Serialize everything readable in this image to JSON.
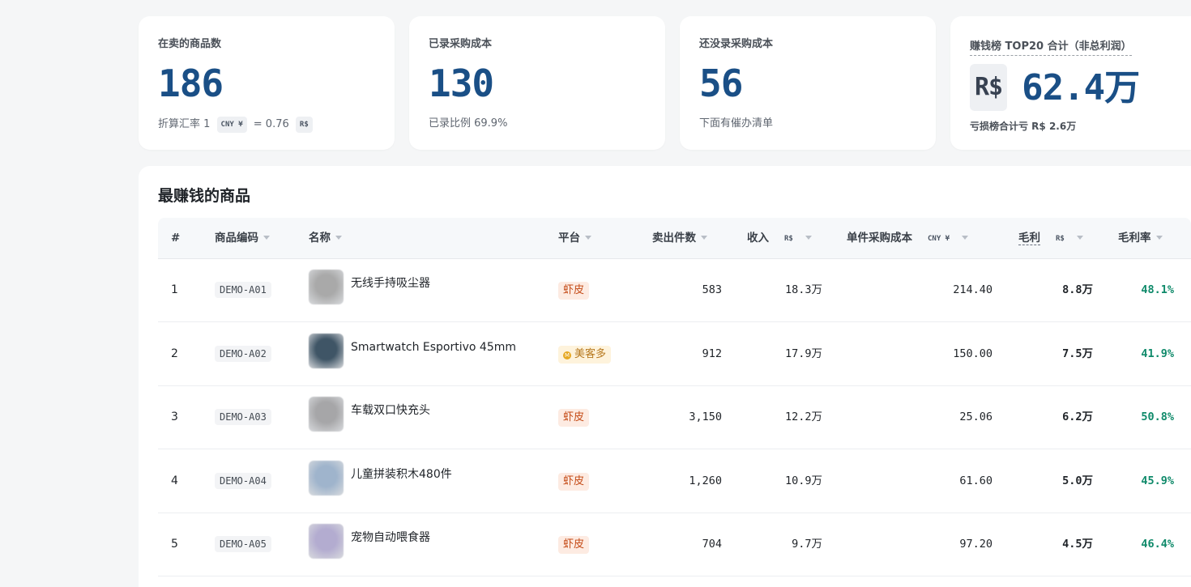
{
  "stats": [
    {
      "label": "在卖的商品数",
      "value": "186",
      "sub_prefix": "折算汇率 1",
      "sub_cny": "CNY ¥",
      "sub_eq": "= 0.76",
      "sub_brl": "R$"
    },
    {
      "label": "已录采购成本",
      "value": "130",
      "sub": "已录比例 69.9%"
    },
    {
      "label": "还没录采购成本",
      "value": "56",
      "sub": "下面有催办清单"
    },
    {
      "label": "赚钱榜 TOP20 合计（非总利润）",
      "currency": "R$",
      "value": "62.4万",
      "sub": "亏损榜合计亏 R$ 2.6万"
    }
  ],
  "table": {
    "title": "最赚钱的商品",
    "headers": {
      "rank": "#",
      "sku": "商品编码",
      "name": "名称",
      "platform": "平台",
      "qty": "卖出件数",
      "revenue": "收入",
      "revenue_unit": "R$",
      "cost": "单件采购成本",
      "cost_unit": "CNY ¥",
      "profit": "毛利",
      "profit_unit": "R$",
      "margin": "毛利率"
    },
    "rows": [
      {
        "rank": "1",
        "sku": "DEMO-A01",
        "name": "无线手持吸尘器",
        "platform": "虾皮",
        "platform_type": "shopee",
        "qty": "583",
        "revenue": "18.3万",
        "cost": "214.40",
        "profit": "8.8万",
        "margin": "48.1%",
        "thumb_color": "#a9a9a9"
      },
      {
        "rank": "2",
        "sku": "DEMO-A02",
        "name": "Smartwatch Esportivo 45mm",
        "platform": "美客多",
        "platform_type": "meituan",
        "qty": "912",
        "revenue": "17.9万",
        "cost": "150.00",
        "profit": "7.5万",
        "margin": "41.9%",
        "thumb_color": "#3f5566"
      },
      {
        "rank": "3",
        "sku": "DEMO-A03",
        "name": "车载双口快充头",
        "platform": "虾皮",
        "platform_type": "shopee",
        "qty": "3,150",
        "revenue": "12.2万",
        "cost": "25.06",
        "profit": "6.2万",
        "margin": "50.8%",
        "thumb_color": "#a6a6a8"
      },
      {
        "rank": "4",
        "sku": "DEMO-A04",
        "name": "儿童拼装积木480件",
        "platform": "虾皮",
        "platform_type": "shopee",
        "qty": "1,260",
        "revenue": "10.9万",
        "cost": "61.60",
        "profit": "5.0万",
        "margin": "45.9%",
        "thumb_color": "#9fb4cc"
      },
      {
        "rank": "5",
        "sku": "DEMO-A05",
        "name": "宠物自动喂食器",
        "platform": "虾皮",
        "platform_type": "shopee",
        "qty": "704",
        "revenue": "9.7万",
        "cost": "97.20",
        "profit": "4.5万",
        "margin": "46.4%",
        "thumb_color": "#b3acd0"
      }
    ]
  }
}
